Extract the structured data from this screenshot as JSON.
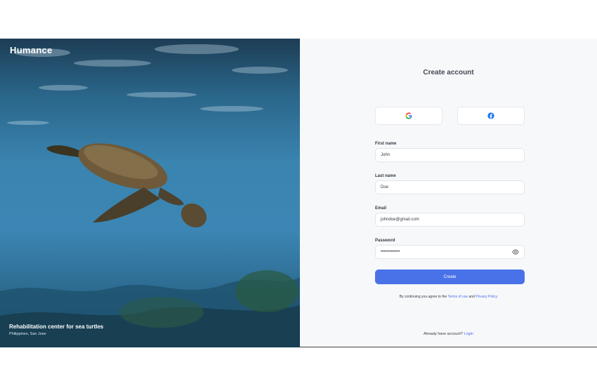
{
  "hero": {
    "brand": "Humance",
    "caption_title": "Rehabilitation center for sea turtles",
    "caption_subtitle": "Philippines, San Jose"
  },
  "form": {
    "title": "Create account",
    "social": [
      {
        "name": "google",
        "icon": "google-icon"
      },
      {
        "name": "facebook",
        "icon": "facebook-icon"
      }
    ],
    "first_name": {
      "label": "First name",
      "value": "John"
    },
    "last_name": {
      "label": "Last name",
      "value": "Doe"
    },
    "email": {
      "label": "Email",
      "value": "johndoe@gmail.com"
    },
    "password": {
      "label": "Password",
      "value": "•••••••••••••",
      "icon": "eye-icon"
    },
    "create_label": "Create",
    "terms_prefix": "By continuing you agree to the",
    "terms_link": "Terms of use",
    "terms_and": "and",
    "privacy_link": "Privacy Policy",
    "footer_prefix": "Already have account?",
    "login_link": "Login"
  },
  "colors": {
    "accent": "#4a72e8",
    "panel_bg": "#f7f8fa",
    "water": "#3a84b0"
  }
}
